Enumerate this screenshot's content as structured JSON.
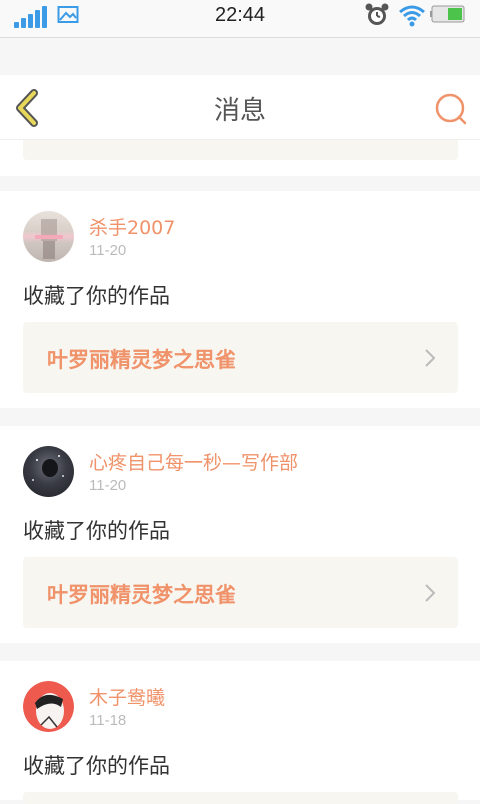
{
  "status_bar": {
    "time": "22:44"
  },
  "header": {
    "title": "消息"
  },
  "notifications": [
    {
      "username": "杀手2007",
      "date": "11-20",
      "action": "收藏了你的作品",
      "work_title": "叶罗丽精灵梦之思雀"
    },
    {
      "username": "心疼自己每一秒—写作部",
      "date": "11-20",
      "action": "收藏了你的作品",
      "work_title": "叶罗丽精灵梦之思雀"
    },
    {
      "username": "木子鸯曦",
      "date": "11-18",
      "action": "收藏了你的作品",
      "work_title": ""
    }
  ],
  "colors": {
    "accent": "#f0926a",
    "back_icon": "#e8d85a",
    "card_inner": "#f7f6f1"
  }
}
